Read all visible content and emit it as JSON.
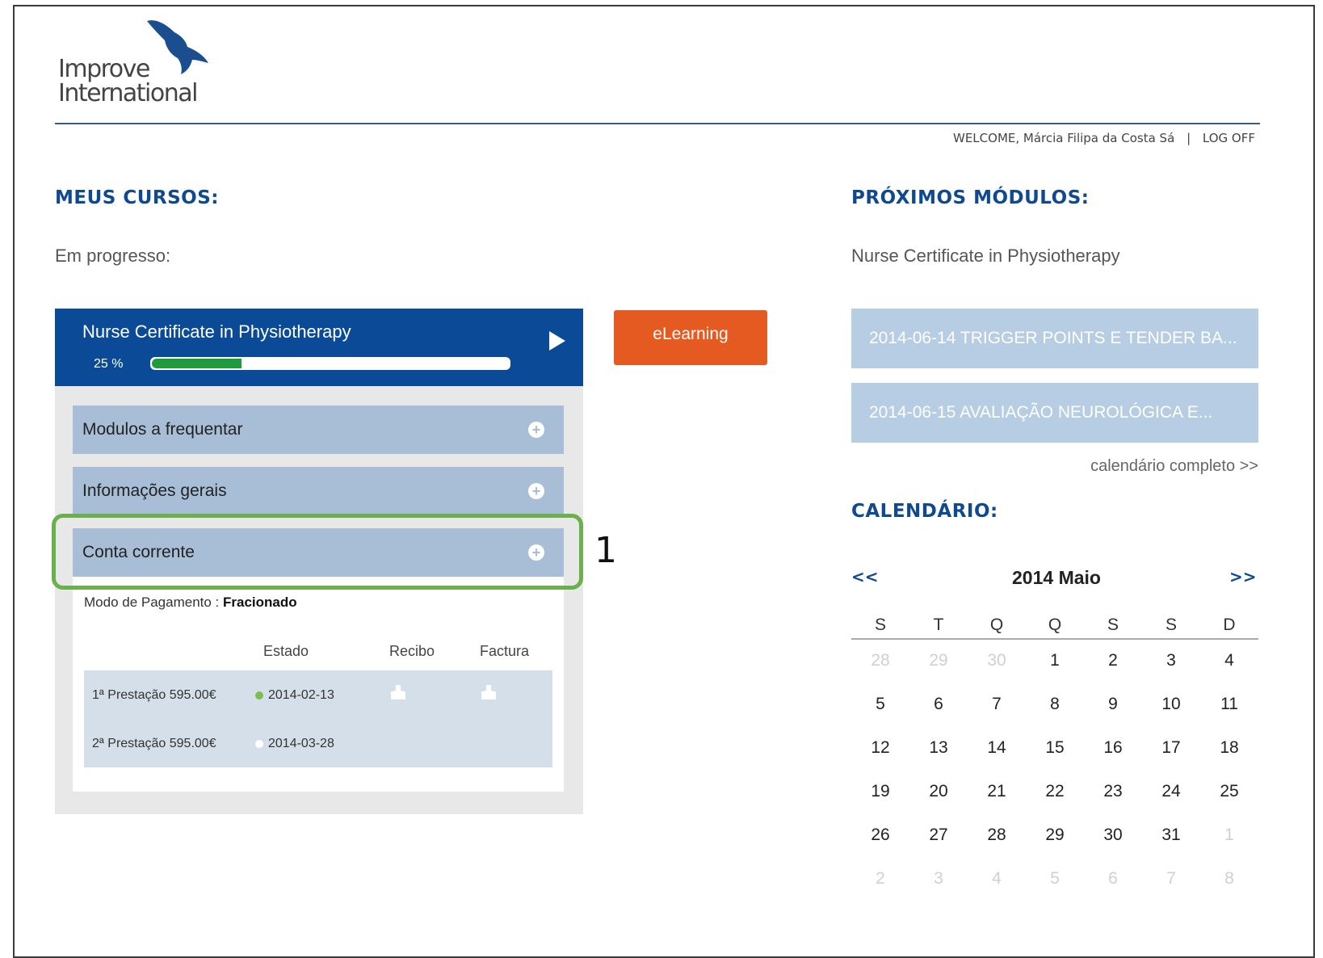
{
  "logo": {
    "line1": "Improve",
    "line2": "International"
  },
  "header": {
    "welcome": "WELCOME, Márcia Filipa da Costa Sá",
    "separator": "|",
    "logoff": "LOG OFF"
  },
  "left": {
    "title": "MEUS CURSOS:",
    "subtitle": "Em progresso:",
    "course": {
      "name": "Nurse Certificate in Physiotherapy",
      "progress_label": "25 %",
      "progress": 0.25
    },
    "accordion": [
      {
        "label": "Modulos a frequentar"
      },
      {
        "label": "Informações gerais"
      },
      {
        "label": "Conta corrente"
      }
    ],
    "conta": {
      "modo_label": "Modo de Pagamento : ",
      "modo_value": "Fracionado",
      "headers": [
        "Estado",
        "Recibo",
        "Factura"
      ],
      "rows": [
        {
          "label": "1ª Prestação 595.00€",
          "date": "2014-02-13",
          "status": "paid"
        },
        {
          "label": "2ª Prestação 595.00€",
          "date": "2014-03-28",
          "status": "pending"
        }
      ]
    },
    "annotation": "1"
  },
  "elearning": "eLearning",
  "right": {
    "title": "PRÓXIMOS MÓDULOS:",
    "subtitle": "Nurse Certificate in Physiotherapy",
    "modules": [
      "2014-06-14 TRIGGER POINTS E TENDER BA...",
      "2014-06-15 AVALIAÇÃO NEUROLÓGICA E..."
    ],
    "calendar_link": "calendário completo >>",
    "calendar_title": "CALENDÁRIO:",
    "calendar": {
      "prev": "<<",
      "next": ">>",
      "month": "2014 Maio",
      "weekdays": [
        "S",
        "T",
        "Q",
        "Q",
        "S",
        "S",
        "D"
      ],
      "weeks": [
        [
          [
            "28",
            1
          ],
          [
            "29",
            1
          ],
          [
            "30",
            1
          ],
          [
            "1",
            0
          ],
          [
            "2",
            0
          ],
          [
            "3",
            0
          ],
          [
            "4",
            0
          ]
        ],
        [
          [
            "5",
            0
          ],
          [
            "6",
            0
          ],
          [
            "7",
            0
          ],
          [
            "8",
            0
          ],
          [
            "9",
            0
          ],
          [
            "10",
            0
          ],
          [
            "11",
            0
          ]
        ],
        [
          [
            "12",
            0
          ],
          [
            "13",
            0
          ],
          [
            "14",
            0
          ],
          [
            "15",
            0
          ],
          [
            "16",
            0
          ],
          [
            "17",
            0
          ],
          [
            "18",
            0
          ]
        ],
        [
          [
            "19",
            0
          ],
          [
            "20",
            0
          ],
          [
            "21",
            0
          ],
          [
            "22",
            0
          ],
          [
            "23",
            0
          ],
          [
            "24",
            0
          ],
          [
            "25",
            0
          ]
        ],
        [
          [
            "26",
            0
          ],
          [
            "27",
            0
          ],
          [
            "28",
            0
          ],
          [
            "29",
            0
          ],
          [
            "30",
            0
          ],
          [
            "31",
            0
          ],
          [
            "1",
            1
          ]
        ],
        [
          [
            "2",
            1
          ],
          [
            "3",
            1
          ],
          [
            "4",
            1
          ],
          [
            "5",
            1
          ],
          [
            "6",
            1
          ],
          [
            "7",
            1
          ],
          [
            "8",
            1
          ]
        ]
      ]
    }
  },
  "colors": {
    "brand": "#0a4a96",
    "accent": "#e45a20",
    "progress": "#1f9a3c",
    "highlight": "#6ab04c"
  }
}
